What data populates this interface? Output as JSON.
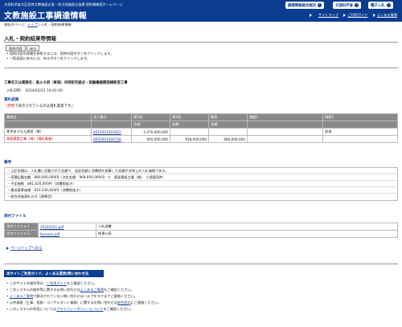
{
  "header": {
    "org_line": "文部科学省大臣官房文教施設企画・防災部施設企画課 契約情報室ホームページ",
    "site_title": "文教施設工事調達情報",
    "buttons": [
      {
        "label": "調達情報総合案内"
      },
      {
        "label": "文部科学省"
      },
      {
        "label": "電子入札"
      }
    ],
    "links": [
      "サイトマップ",
      "ご利用ガイド",
      "よくある質問"
    ]
  },
  "breadcrumb": {
    "prefix": "現在のページ：",
    "top": "トップ",
    "sep": "＞",
    "current": "入札・契約結果情報"
  },
  "page_title": "入札・契約結果等情報",
  "toolbar": {
    "contract_label": "契約内容",
    "back_label": "戻る"
  },
  "instructions": [
    "契約内容の詳細を参照するには、契約内容ボタンをクリックします。",
    "一覧画面に戻るには、戻るボタンをクリックします。"
  ],
  "project": {
    "name": "工事名又は業務名：高エネ研（東海）共同研究拠点・実験機器開発棟新営工事",
    "date_label": "入札日時：",
    "date_value": "2024/02/21 10:01:00"
  },
  "result_section": {
    "heading": "落札結果",
    "note_red": "（赤色",
    "note_rest": "で表示されているのは落札業者です。）"
  },
  "result_table": {
    "headers": [
      "業者名",
      "法人番号",
      "第1回",
      "第2回",
      "随契",
      "摘要1",
      "摘要2"
    ],
    "subheaders": [
      "金額",
      "金額",
      "金額"
    ],
    "rows": [
      {
        "name": "青木あすなろ建設（株）",
        "corp_no": "4010401010452",
        "r1": "1,070,000,000",
        "r2": "",
        "zuikei": "",
        "note1": "",
        "note2": "辞退",
        "winner": false
      },
      {
        "name": "東亜建設工業（株）(落札業者)",
        "corp_no": "8050001004748",
        "r1": "950,000,000",
        "r2": "928,000,000",
        "zuikei": "880,000,000",
        "note1": "",
        "note2": "",
        "winner": true
      }
    ]
  },
  "remarks": {
    "heading": "備考",
    "lines": [
      "・上記金額は、入札書に記載された金額で、当該金額に消費税を加算した金額が決済上の入札価格である。",
      "・見積記載金額　880,000,000円（決定金額　968,000,000円）で　東亜建設工業（株）　と随意契約",
      "・予定価格　881,020,000円（消費税抜き）",
      "・最低基準価格　810,536,400円（消費税抜き）",
      "・総合評価落札方式［標準型］"
    ]
  },
  "attachments": {
    "heading": "添付ファイル",
    "rows": [
      {
        "label": "添付ファイル１",
        "file": "20240221.pdf",
        "desc": "入札調書"
      },
      {
        "label": "添付ファイル２",
        "file": "Ikyouka.pdf",
        "desc": "結果公表"
      }
    ]
  },
  "page_top": "ページトップへ戻る",
  "footer": {
    "heading": "本サイトご利用ガイド、よくある質問/問い合わせ先",
    "items": [
      {
        "pre": "このサイトの操作等は、",
        "link": "ご利用ガイド",
        "post": "をご確認ください。"
      },
      {
        "pre": "このシステムの操作等に関するお問い合わせは",
        "link": "よくあるご質問",
        "post": "をご確認ください。"
      },
      {
        "pre": "",
        "link": "よくあるご質問",
        "post": "で解決されていない問い合わせはヘルプデスクまでご連絡ください。"
      },
      {
        "pre": "公共調達（工事、役務・コンサルタント業務）に関するお問い合わせは",
        "link": "総合窓口",
        "post": "にご連絡ください。"
      },
      {
        "pre": "このシステムの利用については",
        "link": "プライバシーポリシーについて",
        "post": "をご確認ください。"
      }
    ]
  }
}
